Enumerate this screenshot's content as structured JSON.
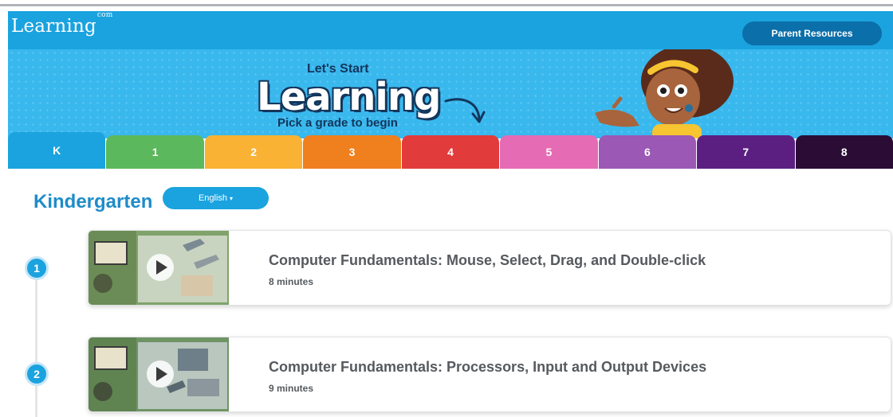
{
  "app": {
    "logo_text": "Learning",
    "logo_suffix": "com"
  },
  "header": {
    "parent_resources_label": "Parent Resources"
  },
  "banner": {
    "tagline_top": "Let's Start",
    "tagline_main": "Learning",
    "tagline_sub": "Pick a grade to begin"
  },
  "grades": [
    {
      "label": "K",
      "color": "#1aa3df",
      "active": true
    },
    {
      "label": "1",
      "color": "#5cb85c"
    },
    {
      "label": "2",
      "color": "#f9b233"
    },
    {
      "label": "3",
      "color": "#f07f1e"
    },
    {
      "label": "4",
      "color": "#e23b3b"
    },
    {
      "label": "5",
      "color": "#e56bb4"
    },
    {
      "label": "6",
      "color": "#9b58b5"
    },
    {
      "label": "7",
      "color": "#5b1f82"
    },
    {
      "label": "8",
      "color": "#2a0c35"
    }
  ],
  "page": {
    "title": "Kindergarten",
    "language_label": "English"
  },
  "lessons": [
    {
      "step": "1",
      "title": "Computer Fundamentals: Mouse, Select, Drag, and Double-click",
      "duration": "8 minutes"
    },
    {
      "step": "2",
      "title": "Computer Fundamentals: Processors, Input and Output Devices",
      "duration": "9 minutes"
    }
  ],
  "colors": {
    "brand_blue": "#1aa3df",
    "button_dark_blue": "#0b6fa9",
    "title_blue": "#1e8cc8",
    "text_gray": "#565a5e"
  },
  "icons": [
    "play-icon",
    "chevron-down-icon",
    "curved-arrow-icon"
  ]
}
